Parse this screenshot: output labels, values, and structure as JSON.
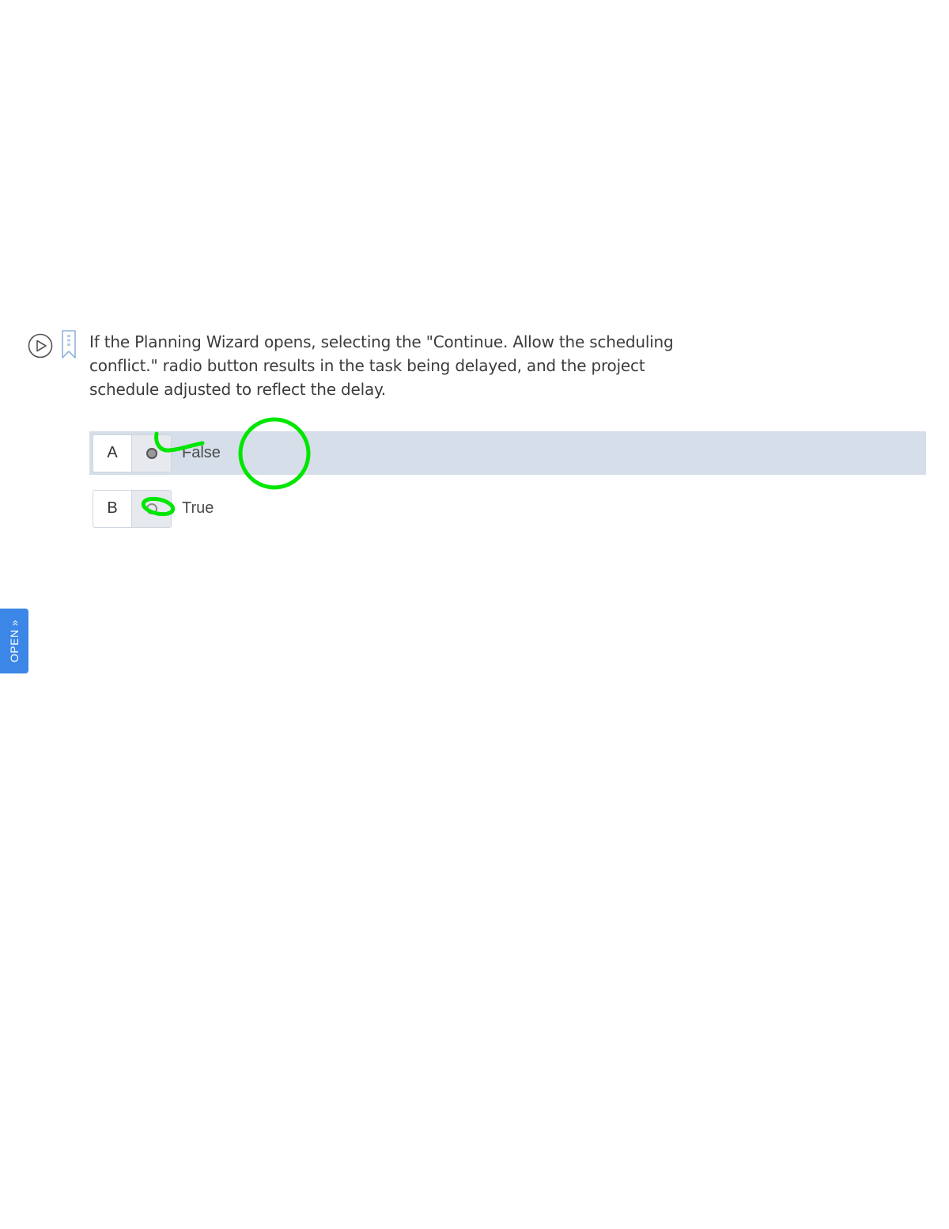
{
  "question": {
    "text": "If the Planning Wizard opens, selecting the \"Continue. Allow the scheduling conflict.\" radio button results in the task being delayed, and the project schedule adjusted to reflect the delay.",
    "tools": {
      "play_icon": "play-circle-icon",
      "bookmark_icon": "bookmark-icon"
    }
  },
  "answers": [
    {
      "letter": "A",
      "label": "False",
      "selected": true
    },
    {
      "letter": "B",
      "label": "True",
      "selected": false
    }
  ],
  "side_tab": {
    "label": "OPEN",
    "icon": "double-chevron-icon",
    "color": "#3b86e6"
  },
  "colors": {
    "selected_row": "#d6dee9",
    "annotation_stroke": "#00e600"
  }
}
